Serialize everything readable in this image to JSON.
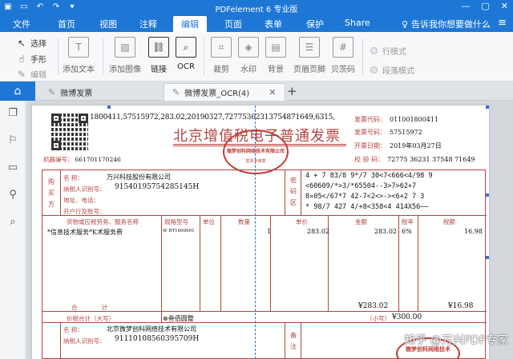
{
  "window": {
    "title": "PDFelement  6 专业版"
  },
  "menu": {
    "items": [
      "文件",
      "首页",
      "视图",
      "注释",
      "编辑",
      "页面",
      "表单",
      "保护",
      "Share"
    ],
    "active": "编辑",
    "help_text": "告诉我你想要做什么"
  },
  "ribbon": {
    "select": "选择",
    "hand": "手形",
    "edit": "编辑",
    "add_text": "添加文本",
    "add_image": "添加图像",
    "link": "链接",
    "ocr": "OCR",
    "crop": "裁剪",
    "watermark": "水印",
    "background": "背景",
    "header_footer": "页眉页脚",
    "bates": "贝茨码",
    "line_mode": "行模式",
    "paragraph_mode": "段落模式"
  },
  "tabs": [
    {
      "label": "微博发票"
    },
    {
      "label": "微博发票_OCR(4)"
    }
  ],
  "invoice": {
    "code_line": "1800411,57515972,283.02,20190327,72775362313754871649,6315,",
    "title": "北京增值税电子普通发票",
    "seal_top": "微梦创科网络技术有限公司",
    "seal_bottom": "发票专用章",
    "invoice_code_label": "发票代码：",
    "invoice_code": "011001800411",
    "invoice_no_label": "发票号码：",
    "invoice_no": "57515972",
    "issue_date_label": "开票日期：",
    "issue_date": "2019年03月27日",
    "check_label": "校  验  码：",
    "check_code": "72775 36231 37548 71649",
    "machine_label": "机器编号：",
    "machine_no": "661701170246",
    "buyer_side": [
      "购",
      "买",
      "方"
    ],
    "name_label": "名        称：",
    "buyer_name": "万兴科技股份有限公司",
    "taxid_label": "纳税人识别号：",
    "buyer_taxid": "91540195754285145H",
    "addr_label": "地址、电话：",
    "bank_label": "开户行及账号：",
    "cipher_side": [
      "密",
      "码",
      "区"
    ],
    "cipher_lines": [
      "4 + 7 83/8 9*/7 30<7<666<4/98 9",
      "<60609/*>3/*65504--3>7>62+7",
      "8»05</67*7 42-7<2<>-><6+2 7 3",
      "* 98/7 427 4/+8<358<4 414X56——"
    ],
    "col_goods": "货物或应税劳务、服务名称",
    "col_spec": "规格型号",
    "col_unit": "单位",
    "col_qty": "数量",
    "col_price": "单价",
    "col_amount": "金额",
    "col_rate": "税率",
    "col_tax": "税额",
    "goods_name": "*信息技术服务*K术服务费",
    "spec": "W BT1600001",
    "qty": "1",
    "price": "283.02",
    "amount": "283.02",
    "rate": "6%",
    "tax": "16.98",
    "total_label_1": "合",
    "total_label_2": "计",
    "total_amount": "¥283.02",
    "total_tax": "¥16.98",
    "grand_label": "价税合计（大写）",
    "grand_text": "⊗叁佰圆整",
    "small_label": "（小写）",
    "small_value": "¥300.00",
    "seller_name_label": "名        称：",
    "seller_name": "北京微梦创科网络技术有限公司",
    "seller_taxid_label": "纳税人识别号：",
    "seller_taxid": "91110108560395709H",
    "seller_seal": "微梦创科网络技术",
    "remark_side": [
      "备",
      "注"
    ]
  },
  "watermark_text": "知乎 @万兴PDF专家"
}
